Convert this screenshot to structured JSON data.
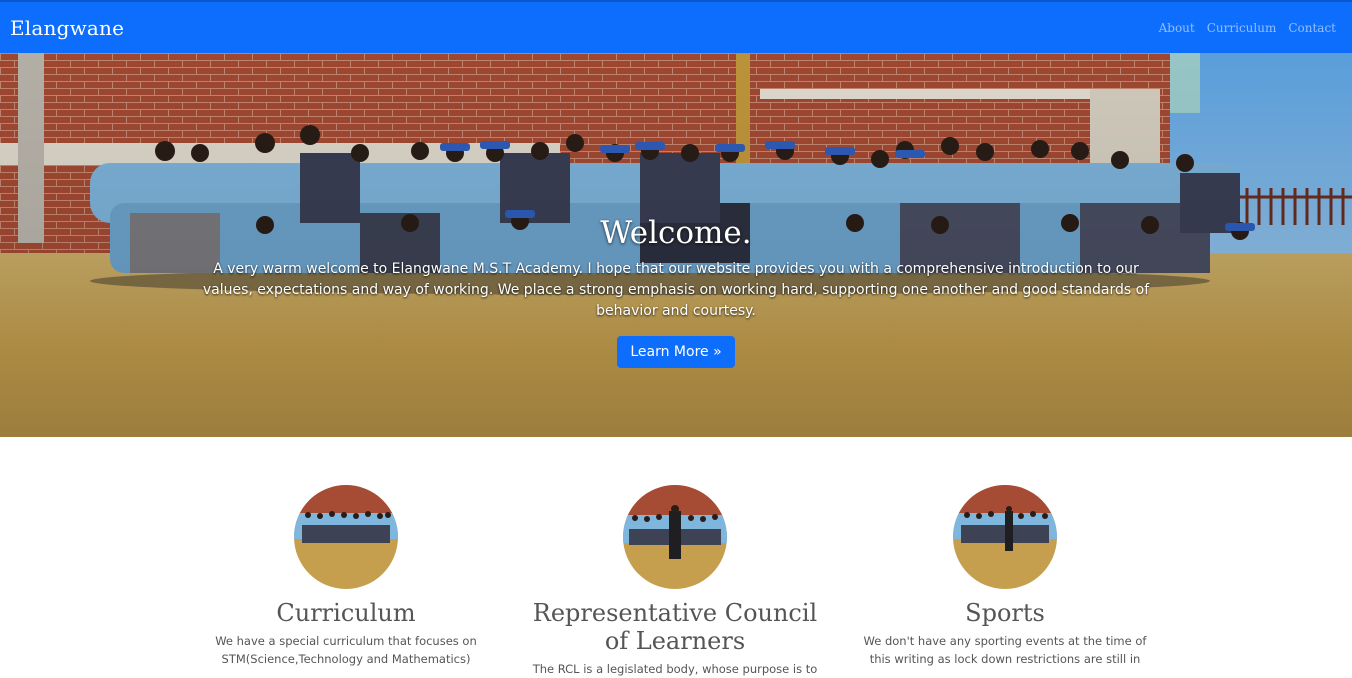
{
  "navbar": {
    "brand": "Elangwane",
    "links": [
      "About",
      "Curriculum",
      "Contact"
    ]
  },
  "hero": {
    "title": "Welcome.",
    "text": "A very warm welcome to Elangwane M.S.T Academy. I hope that our website provides you with a comprehensive introduction to our values, expectations and way of working. We place a strong emphasis on working hard, supporting one another and good standards of behavior and courtesy.",
    "button_label": "Learn More »"
  },
  "cards": [
    {
      "title": "Curriculum",
      "text": "We have a special curriculum that focuses on STM(Science,Technology and Mathematics)"
    },
    {
      "title": "Representative Council of Learners",
      "text": "The RCL is a legislated body, whose purpose is to"
    },
    {
      "title": "Sports",
      "text": "We don't have any sporting events at the time of this writing as lock down restrictions are still in"
    }
  ],
  "colors": {
    "navbar": "#0d6efd",
    "button": "#0d6efd",
    "brick": "#a34a33",
    "grass": "#c9a653",
    "uniform": "#7fb6de"
  }
}
